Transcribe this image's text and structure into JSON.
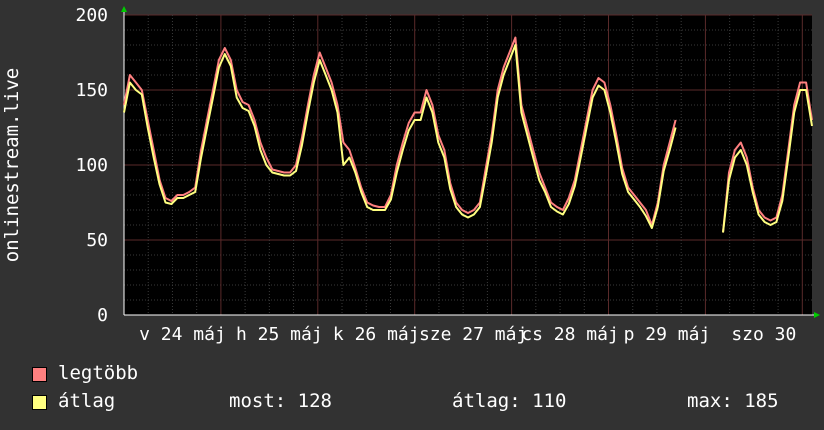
{
  "chart_data": {
    "type": "line",
    "ylabel": "onlinestream.live",
    "ylim": [
      0,
      200
    ],
    "yticks": [
      0,
      50,
      100,
      150,
      200
    ],
    "x_tick_labels": [
      "v 24 máj",
      "h 25 máj",
      "k 26 máj",
      "sze 27 máj",
      "cs 28 máj",
      "p 29 máj",
      "szo 30"
    ],
    "series": [
      {
        "name": "legtöbb",
        "color": "#ff8080",
        "values": [
          140,
          160,
          155,
          150,
          130,
          110,
          90,
          78,
          76,
          80,
          80,
          82,
          85,
          110,
          130,
          150,
          170,
          178,
          170,
          150,
          142,
          140,
          130,
          115,
          105,
          97,
          96,
          95,
          95,
          100,
          118,
          140,
          160,
          175,
          165,
          155,
          140,
          115,
          110,
          98,
          85,
          75,
          73,
          72,
          72,
          80,
          100,
          115,
          128,
          135,
          135,
          150,
          140,
          120,
          110,
          88,
          75,
          70,
          68,
          70,
          75,
          98,
          120,
          150,
          165,
          175,
          185,
          140,
          125,
          110,
          95,
          85,
          75,
          72,
          70,
          78,
          90,
          110,
          130,
          150,
          158,
          155,
          140,
          120,
          98,
          85,
          80,
          75,
          70,
          60,
          75,
          100,
          115,
          130,
          null,
          null,
          null,
          null,
          null,
          null,
          null,
          55,
          95,
          110,
          115,
          105,
          85,
          70,
          65,
          63,
          65,
          80,
          110,
          140,
          155,
          155,
          130
        ]
      },
      {
        "name": "átlag",
        "color": "#ffff80",
        "values": [
          135,
          155,
          150,
          147,
          125,
          105,
          87,
          75,
          74,
          78,
          78,
          80,
          82,
          105,
          125,
          145,
          165,
          174,
          166,
          145,
          138,
          136,
          126,
          110,
          100,
          95,
          94,
          93,
          93,
          96,
          113,
          135,
          155,
          170,
          160,
          150,
          135,
          100,
          105,
          95,
          82,
          72,
          70,
          70,
          70,
          77,
          95,
          110,
          123,
          130,
          130,
          145,
          135,
          115,
          105,
          84,
          72,
          67,
          65,
          67,
          72,
          93,
          115,
          145,
          160,
          170,
          180,
          135,
          120,
          105,
          90,
          82,
          72,
          69,
          67,
          74,
          86,
          105,
          125,
          145,
          153,
          150,
          135,
          115,
          94,
          82,
          77,
          72,
          66,
          58,
          72,
          96,
          110,
          125,
          null,
          null,
          null,
          null,
          null,
          null,
          null,
          55,
          90,
          105,
          110,
          100,
          82,
          67,
          62,
          60,
          62,
          76,
          105,
          135,
          150,
          150,
          126
        ]
      }
    ],
    "legend": [
      {
        "label": "legtöbb",
        "color": "#ff8080"
      },
      {
        "label": "átlag",
        "color": "#ffff80"
      }
    ],
    "stats": [
      {
        "label": "most:",
        "value": "128"
      },
      {
        "label": "átlag:",
        "value": "110"
      },
      {
        "label": "max:",
        "value": "185"
      }
    ]
  }
}
